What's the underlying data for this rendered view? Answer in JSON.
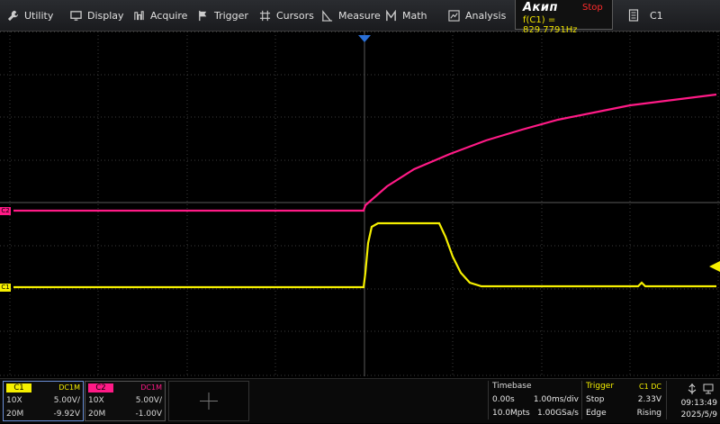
{
  "menu": {
    "items": [
      {
        "label": "Utility",
        "icon": "wrench-icon"
      },
      {
        "label": "Display",
        "icon": "monitor-icon"
      },
      {
        "label": "Acquire",
        "icon": "acquire-icon"
      },
      {
        "label": "Trigger",
        "icon": "flag-icon"
      },
      {
        "label": "Cursors",
        "icon": "crosshair-icon"
      },
      {
        "label": "Measure",
        "icon": "measure-icon"
      },
      {
        "label": "Math",
        "icon": "math-icon"
      },
      {
        "label": "Analysis",
        "icon": "analysis-icon"
      }
    ],
    "brand": "Акип",
    "run_state": "Stop",
    "frequency": "f(C1) = 829.7791Hz",
    "channel": "C1"
  },
  "markers": {
    "c2": "C2",
    "c1": "C1"
  },
  "channels": {
    "c1": {
      "tag": "C1",
      "coupling": "DC1M",
      "probe": "10X",
      "scale": "5.00V/",
      "bw": "20M",
      "offset": "-9.92V",
      "color": "#f5ef00"
    },
    "c2": {
      "tag": "C2",
      "coupling": "DC1M",
      "probe": "10X",
      "scale": "5.00V/",
      "bw": "20M",
      "offset": "-1.00V",
      "color": "#ff1a86"
    }
  },
  "timebase": {
    "title": "Timebase",
    "delay": "0.00s",
    "scale": "1.00ms/div",
    "points": "10.0Mpts",
    "rate": "1.00GSa/s"
  },
  "trigger": {
    "title": "Trigger",
    "source": "C1 DC",
    "mode": "Stop",
    "level": "2.33V",
    "type": "Edge",
    "slope": "Rising"
  },
  "status": {
    "time": "09:13:49",
    "date": "2025/5/9"
  }
}
